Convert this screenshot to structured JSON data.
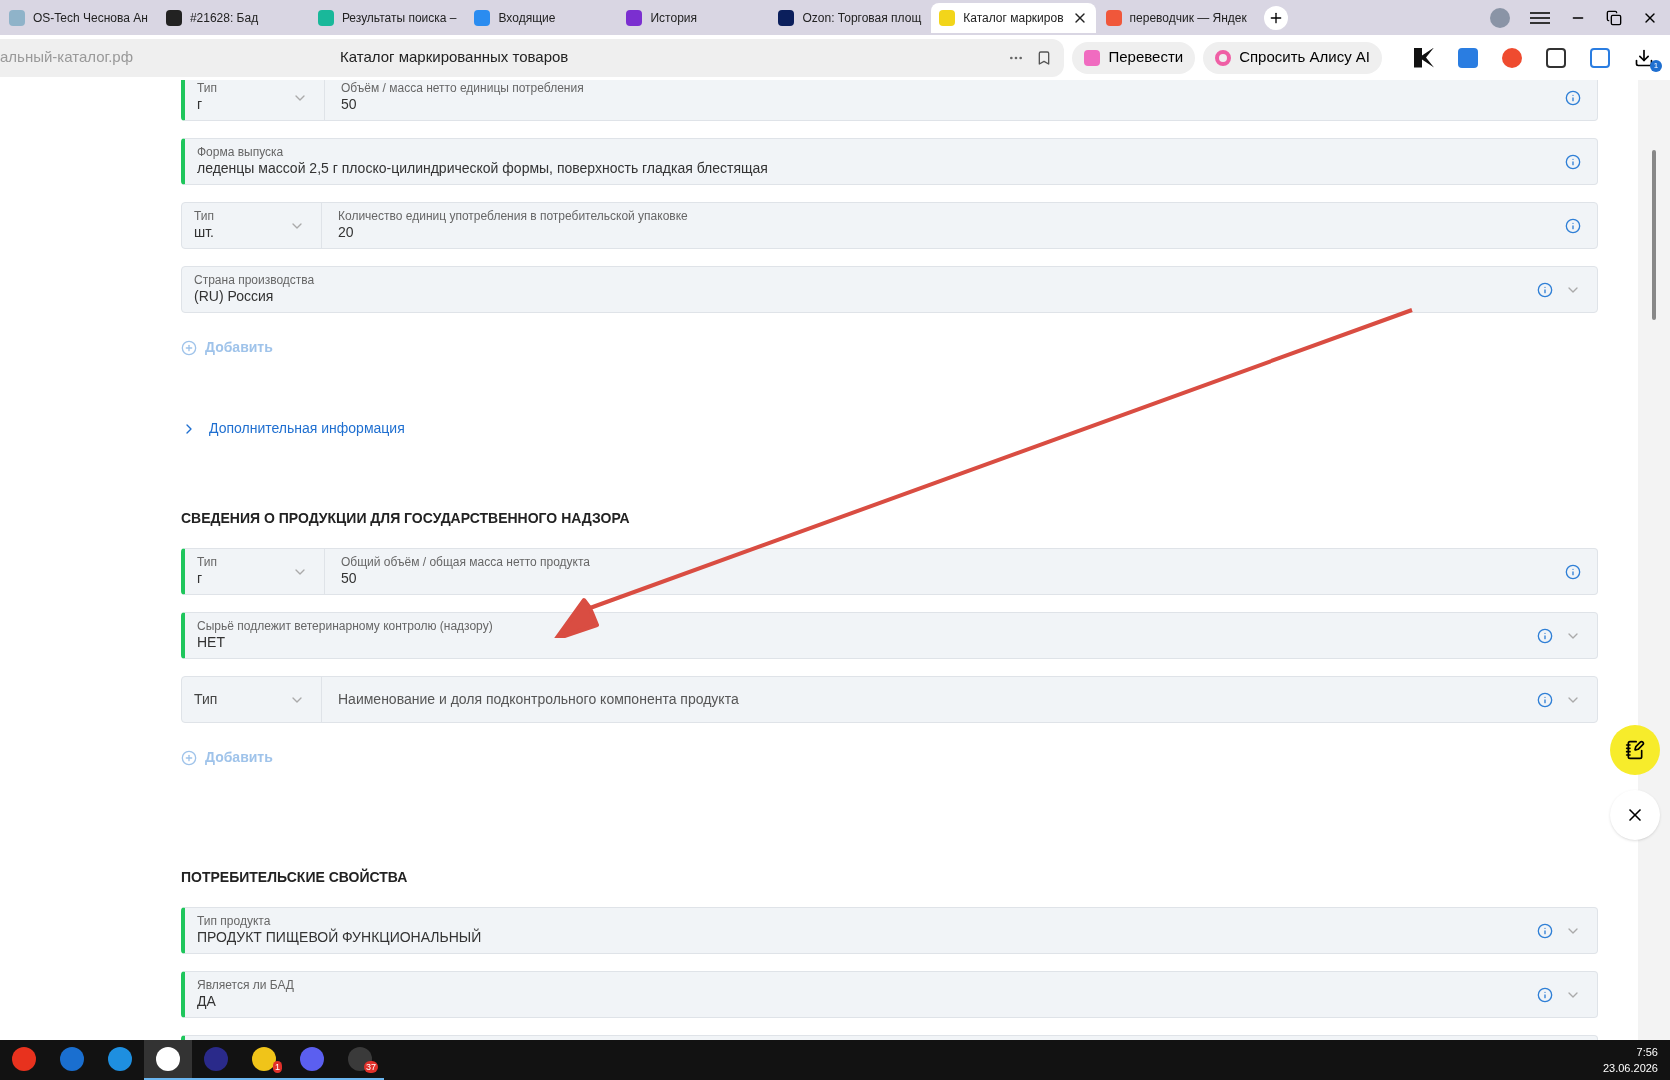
{
  "browser": {
    "tabs": [
      {
        "title": "OS-Tech Чеснова Ан",
        "color": "#8fb3c9",
        "selected": false
      },
      {
        "title": "#21628: Бад",
        "color": "#222222",
        "selected": false
      },
      {
        "title": "Результаты поиска –",
        "color": "#19b89a",
        "selected": false
      },
      {
        "title": "Входящие",
        "color": "#2a8cf0",
        "selected": false
      },
      {
        "title": "История",
        "color": "#7b2fd0",
        "selected": false
      },
      {
        "title": "Ozon: Торговая площ",
        "color": "#0b1f5c",
        "selected": false
      },
      {
        "title": "Каталог маркиров",
        "color": "#f2d51a",
        "selected": true
      },
      {
        "title": "переводчик — Яндек",
        "color": "#f0573a",
        "selected": false
      }
    ],
    "address": "альный-каталог.рф",
    "page_title": "Каталог маркированных товаров",
    "buttons": [
      "Перевести",
      "Спросить Алису AI"
    ],
    "download_badge": "1"
  },
  "content": [
    {
      "kind": "field",
      "valid": true,
      "dropdown": false,
      "unit": {
        "label": "Тип",
        "value": "г"
      },
      "label": "Объём / масса нетто единицы потребления",
      "value": "50"
    },
    {
      "kind": "field",
      "valid": true,
      "dropdown": false,
      "label": "Форма выпуска",
      "value": "леденцы массой 2,5 г плоско-цилиндрической формы, поверхность гладкая блестящая"
    },
    {
      "kind": "field",
      "valid": false,
      "dropdown": false,
      "unit": {
        "label": "Тип",
        "value": "шт."
      },
      "label": "Количество единиц употребления в потребительской упаковке",
      "value": "20"
    },
    {
      "kind": "field",
      "valid": false,
      "dropdown": true,
      "label": "Страна производства",
      "value": "(RU) Россия"
    },
    {
      "kind": "add",
      "text": "Добавить"
    },
    {
      "kind": "expander",
      "text": "Дополнительная информация",
      "expanded": false
    },
    {
      "kind": "heading",
      "text": "СВЕДЕНИЯ О ПРОДУКЦИИ ДЛЯ ГОСУДАРСТВЕННОГО НАДЗОРА"
    },
    {
      "kind": "field",
      "valid": true,
      "dropdown": false,
      "unit": {
        "label": "Тип",
        "value": "г"
      },
      "label": "Общий объём / общая масса нетто продукта",
      "value": "50"
    },
    {
      "kind": "field",
      "valid": true,
      "dropdown": true,
      "label": "Сырьё подлежит ветеринарному контролю (надзору)",
      "value": "НЕТ"
    },
    {
      "kind": "field",
      "valid": false,
      "dropdown": true,
      "unit": {
        "placeholder": "Тип"
      },
      "placeholder": "Наименование и доля подконтрольного компонента продукта"
    },
    {
      "kind": "add",
      "text": "Добавить"
    },
    {
      "kind": "heading",
      "text": "ПОТРЕБИТЕЛЬСКИЕ СВОЙСТВА"
    },
    {
      "kind": "field",
      "valid": true,
      "dropdown": true,
      "label": "Тип продукта",
      "value": "ПРОДУКТ ПИЩЕВОЙ ФУНКЦИОНАЛЬНЫЙ"
    },
    {
      "kind": "field",
      "valid": true,
      "dropdown": true,
      "label": "Является ли БАД",
      "value": "ДА"
    }
  ],
  "taskbar": {
    "apps": [
      {
        "color": "#e8321e",
        "selected": false,
        "running": false
      },
      {
        "color": "#1a6fd0",
        "selected": false,
        "running": false
      },
      {
        "color": "#1e8fe0",
        "selected": false,
        "running": false
      },
      {
        "color": "#ffffff",
        "selected": true,
        "running": true
      },
      {
        "color": "#2a2a8a",
        "selected": false,
        "running": true
      },
      {
        "color": "#f0c419",
        "selected": false,
        "running": true,
        "badge": "1"
      },
      {
        "color": "#5b5ff0",
        "selected": false,
        "running": true
      },
      {
        "color": "#3a3a3a",
        "selected": false,
        "running": true,
        "badge": "37"
      }
    ],
    "time": "7:56",
    "date": "23.06.2026"
  }
}
